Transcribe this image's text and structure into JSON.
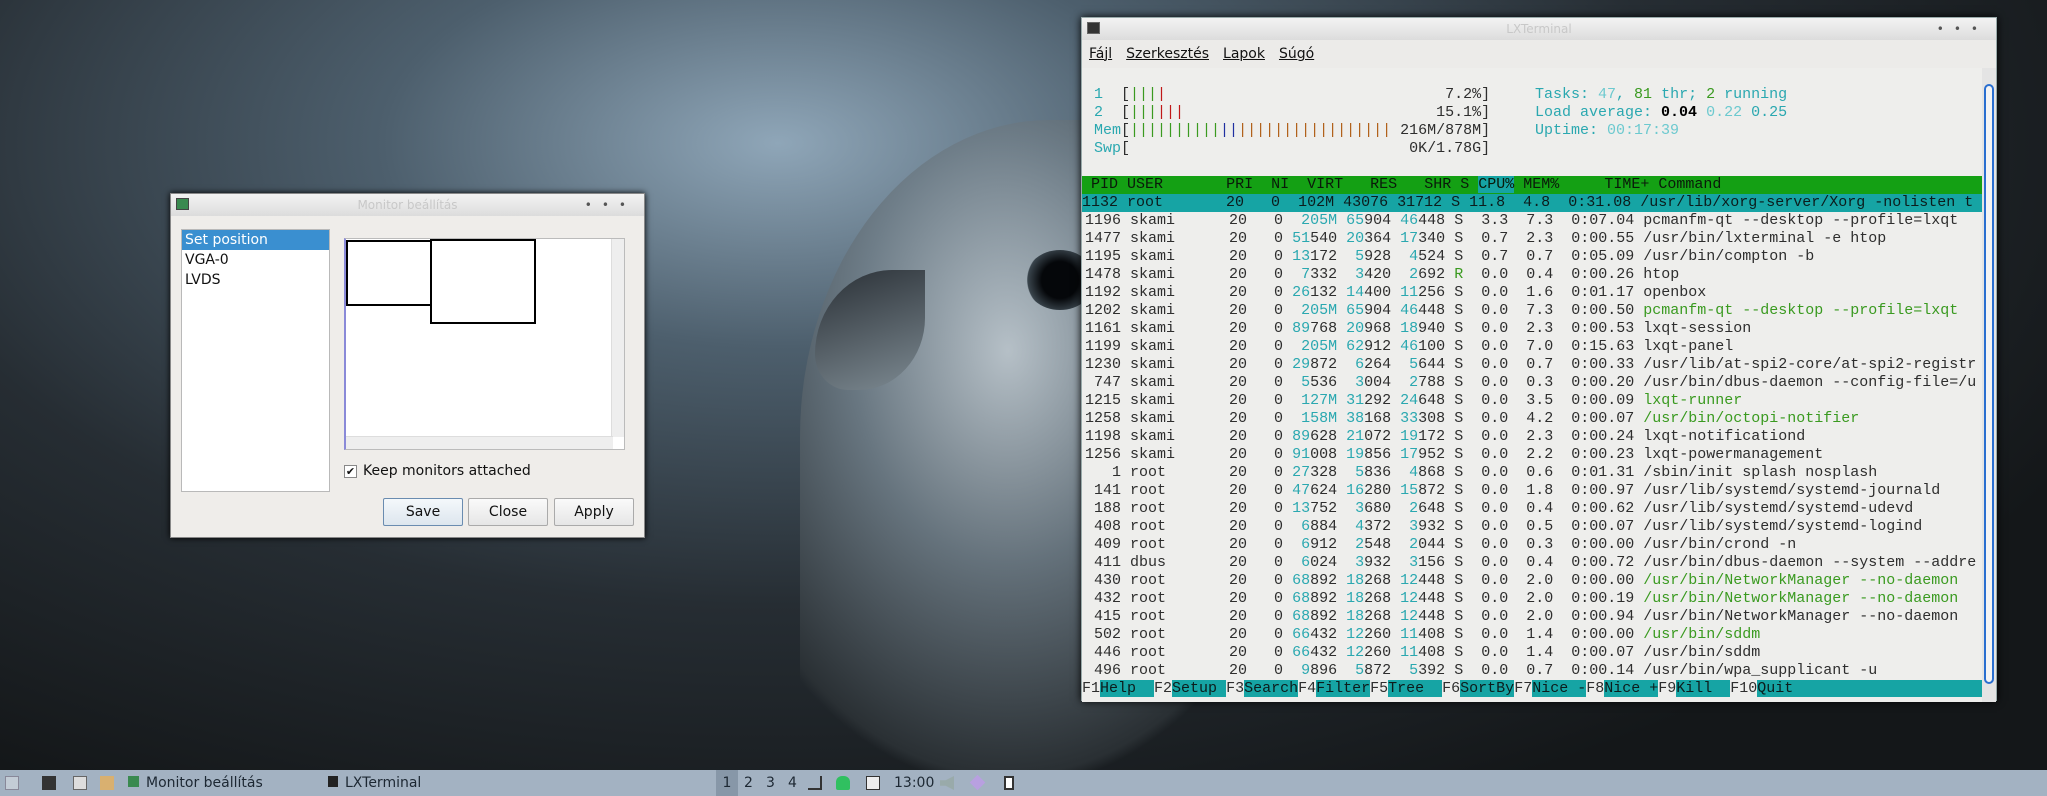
{
  "terminal": {
    "title": "LXTerminal",
    "menu": [
      "Fájl",
      "Szerkesztés",
      "Lapok",
      "Súgó"
    ],
    "meters": [
      {
        "label": "1",
        "value": "7.2%",
        "segments": [
          [
            "gr",
            3
          ],
          [
            "rd",
            1
          ]
        ]
      },
      {
        "label": "2",
        "value": "15.1%",
        "segments": [
          [
            "gr",
            3
          ],
          [
            "rd",
            3
          ]
        ]
      },
      {
        "label": "Mem",
        "value": "216M/878M",
        "segments": [
          [
            "gr",
            10
          ],
          [
            "bl",
            2
          ],
          [
            "or",
            17
          ]
        ]
      },
      {
        "label": "Swp",
        "value": "0K/1.78G",
        "segments": []
      }
    ],
    "tasks": {
      "label": "Tasks: ",
      "count": "47",
      "sep": ", ",
      "threads": "81",
      "thr_label": " thr; ",
      "running": "2",
      "running_label": " running"
    },
    "load": {
      "label": "Load average: ",
      "l1": "0.04",
      "l5": "0.22",
      "l15": "0.25"
    },
    "uptime": {
      "label": "Uptime: ",
      "value": "00:17:39"
    },
    "columns": [
      "PID",
      "USER",
      "PRI",
      "NI",
      "VIRT",
      "RES",
      "SHR",
      "S",
      "CPU%",
      "MEM%",
      "TIME+",
      "Command"
    ],
    "sort_column": "CPU%",
    "processes": [
      {
        "pid": "1132",
        "user": "root",
        "pri": "20",
        "ni": "0",
        "virt": "102M",
        "res": "43076",
        "shr": "31712",
        "s": "S",
        "cpu": "11.8",
        "mem": "4.8",
        "time": "0:31.08",
        "cmd": "/usr/lib/xorg-server/Xorg -nolisten t",
        "selected": true
      },
      {
        "pid": "1196",
        "user": "skami",
        "pri": "20",
        "ni": "0",
        "virt": "205M",
        "res": "65904",
        "shr": "46448",
        "s": "S",
        "cpu": "3.3",
        "mem": "7.3",
        "time": "0:07.04",
        "cmd": "pcmanfm-qt --desktop --profile=lxqt"
      },
      {
        "pid": "1477",
        "user": "skami",
        "pri": "20",
        "ni": "0",
        "virt": "51540",
        "res": "20364",
        "shr": "17340",
        "s": "S",
        "cpu": "0.7",
        "mem": "2.3",
        "time": "0:00.55",
        "cmd": "/usr/bin/lxterminal -e htop"
      },
      {
        "pid": "1195",
        "user": "skami",
        "pri": "20",
        "ni": "0",
        "virt": "13172",
        "res": "5928",
        "shr": "4524",
        "s": "S",
        "cpu": "0.7",
        "mem": "0.7",
        "time": "0:05.09",
        "cmd": "/usr/bin/compton -b"
      },
      {
        "pid": "1478",
        "user": "skami",
        "pri": "20",
        "ni": "0",
        "virt": "7332",
        "res": "3420",
        "shr": "2692",
        "s": "R",
        "cpu": "0.0",
        "mem": "0.4",
        "time": "0:00.26",
        "cmd": "htop"
      },
      {
        "pid": "1192",
        "user": "skami",
        "pri": "20",
        "ni": "0",
        "virt": "26132",
        "res": "14400",
        "shr": "11256",
        "s": "S",
        "cpu": "0.0",
        "mem": "1.6",
        "time": "0:01.17",
        "cmd": "openbox"
      },
      {
        "pid": "1202",
        "user": "skami",
        "pri": "20",
        "ni": "0",
        "virt": "205M",
        "res": "65904",
        "shr": "46448",
        "s": "S",
        "cpu": "0.0",
        "mem": "7.3",
        "time": "0:00.50",
        "cmd": "pcmanfm-qt --desktop --profile=lxqt",
        "thread": true
      },
      {
        "pid": "1161",
        "user": "skami",
        "pri": "20",
        "ni": "0",
        "virt": "89768",
        "res": "20968",
        "shr": "18940",
        "s": "S",
        "cpu": "0.0",
        "mem": "2.3",
        "time": "0:00.53",
        "cmd": "lxqt-session"
      },
      {
        "pid": "1199",
        "user": "skami",
        "pri": "20",
        "ni": "0",
        "virt": "205M",
        "res": "62912",
        "shr": "46100",
        "s": "S",
        "cpu": "0.0",
        "mem": "7.0",
        "time": "0:15.63",
        "cmd": "lxqt-panel"
      },
      {
        "pid": "1230",
        "user": "skami",
        "pri": "20",
        "ni": "0",
        "virt": "29872",
        "res": "6264",
        "shr": "5644",
        "s": "S",
        "cpu": "0.0",
        "mem": "0.7",
        "time": "0:00.33",
        "cmd": "/usr/lib/at-spi2-core/at-spi2-registr"
      },
      {
        "pid": "747",
        "user": "skami",
        "pri": "20",
        "ni": "0",
        "virt": "5536",
        "res": "3004",
        "shr": "2788",
        "s": "S",
        "cpu": "0.0",
        "mem": "0.3",
        "time": "0:00.20",
        "cmd": "/usr/bin/dbus-daemon --config-file=/u"
      },
      {
        "pid": "1215",
        "user": "skami",
        "pri": "20",
        "ni": "0",
        "virt": "127M",
        "res": "31292",
        "shr": "24648",
        "s": "S",
        "cpu": "0.0",
        "mem": "3.5",
        "time": "0:00.09",
        "cmd": "lxqt-runner",
        "thread": true
      },
      {
        "pid": "1258",
        "user": "skami",
        "pri": "20",
        "ni": "0",
        "virt": "158M",
        "res": "38168",
        "shr": "33308",
        "s": "S",
        "cpu": "0.0",
        "mem": "4.2",
        "time": "0:00.07",
        "cmd": "/usr/bin/octopi-notifier",
        "thread": true
      },
      {
        "pid": "1198",
        "user": "skami",
        "pri": "20",
        "ni": "0",
        "virt": "89628",
        "res": "21072",
        "shr": "19172",
        "s": "S",
        "cpu": "0.0",
        "mem": "2.3",
        "time": "0:00.24",
        "cmd": "lxqt-notificationd"
      },
      {
        "pid": "1256",
        "user": "skami",
        "pri": "20",
        "ni": "0",
        "virt": "91008",
        "res": "19856",
        "shr": "17952",
        "s": "S",
        "cpu": "0.0",
        "mem": "2.2",
        "time": "0:00.23",
        "cmd": "lxqt-powermanagement"
      },
      {
        "pid": "1",
        "user": "root",
        "pri": "20",
        "ni": "0",
        "virt": "27328",
        "res": "5836",
        "shr": "4868",
        "s": "S",
        "cpu": "0.0",
        "mem": "0.6",
        "time": "0:01.31",
        "cmd": "/sbin/init splash nosplash"
      },
      {
        "pid": "141",
        "user": "root",
        "pri": "20",
        "ni": "0",
        "virt": "47624",
        "res": "16280",
        "shr": "15872",
        "s": "S",
        "cpu": "0.0",
        "mem": "1.8",
        "time": "0:00.97",
        "cmd": "/usr/lib/systemd/systemd-journald"
      },
      {
        "pid": "188",
        "user": "root",
        "pri": "20",
        "ni": "0",
        "virt": "13752",
        "res": "3680",
        "shr": "2648",
        "s": "S",
        "cpu": "0.0",
        "mem": "0.4",
        "time": "0:00.62",
        "cmd": "/usr/lib/systemd/systemd-udevd"
      },
      {
        "pid": "408",
        "user": "root",
        "pri": "20",
        "ni": "0",
        "virt": "6884",
        "res": "4372",
        "shr": "3932",
        "s": "S",
        "cpu": "0.0",
        "mem": "0.5",
        "time": "0:00.07",
        "cmd": "/usr/lib/systemd/systemd-logind"
      },
      {
        "pid": "409",
        "user": "root",
        "pri": "20",
        "ni": "0",
        "virt": "6912",
        "res": "2548",
        "shr": "2044",
        "s": "S",
        "cpu": "0.0",
        "mem": "0.3",
        "time": "0:00.00",
        "cmd": "/usr/bin/crond -n"
      },
      {
        "pid": "411",
        "user": "dbus",
        "pri": "20",
        "ni": "0",
        "virt": "6024",
        "res": "3932",
        "shr": "3156",
        "s": "S",
        "cpu": "0.0",
        "mem": "0.4",
        "time": "0:00.72",
        "cmd": "/usr/bin/dbus-daemon --system --addre"
      },
      {
        "pid": "430",
        "user": "root",
        "pri": "20",
        "ni": "0",
        "virt": "68892",
        "res": "18268",
        "shr": "12448",
        "s": "S",
        "cpu": "0.0",
        "mem": "2.0",
        "time": "0:00.00",
        "cmd": "/usr/bin/NetworkManager --no-daemon",
        "thread": true
      },
      {
        "pid": "432",
        "user": "root",
        "pri": "20",
        "ni": "0",
        "virt": "68892",
        "res": "18268",
        "shr": "12448",
        "s": "S",
        "cpu": "0.0",
        "mem": "2.0",
        "time": "0:00.19",
        "cmd": "/usr/bin/NetworkManager --no-daemon",
        "thread": true
      },
      {
        "pid": "415",
        "user": "root",
        "pri": "20",
        "ni": "0",
        "virt": "68892",
        "res": "18268",
        "shr": "12448",
        "s": "S",
        "cpu": "0.0",
        "mem": "2.0",
        "time": "0:00.94",
        "cmd": "/usr/bin/NetworkManager --no-daemon"
      },
      {
        "pid": "502",
        "user": "root",
        "pri": "20",
        "ni": "0",
        "virt": "66432",
        "res": "12260",
        "shr": "11408",
        "s": "S",
        "cpu": "0.0",
        "mem": "1.4",
        "time": "0:00.00",
        "cmd": "/usr/bin/sddm",
        "thread": true
      },
      {
        "pid": "446",
        "user": "root",
        "pri": "20",
        "ni": "0",
        "virt": "66432",
        "res": "12260",
        "shr": "11408",
        "s": "S",
        "cpu": "0.0",
        "mem": "1.4",
        "time": "0:00.07",
        "cmd": "/usr/bin/sddm"
      },
      {
        "pid": "496",
        "user": "root",
        "pri": "20",
        "ni": "0",
        "virt": "9896",
        "res": "5872",
        "shr": "5392",
        "s": "S",
        "cpu": "0.0",
        "mem": "0.7",
        "time": "0:00.14",
        "cmd": "/usr/bin/wpa_supplicant -u"
      }
    ],
    "fkeys": [
      [
        "F1",
        "Help  "
      ],
      [
        "F2",
        "Setup "
      ],
      [
        "F3",
        "Search"
      ],
      [
        "F4",
        "Filter"
      ],
      [
        "F5",
        "Tree  "
      ],
      [
        "F6",
        "SortBy"
      ],
      [
        "F7",
        "Nice -"
      ],
      [
        "F8",
        "Nice +"
      ],
      [
        "F9",
        "Kill  "
      ],
      [
        "F10",
        "Quit"
      ]
    ]
  },
  "dialog": {
    "title": "Monitor beállítás",
    "list": [
      "Set position",
      "VGA-0",
      "LVDS"
    ],
    "checkbox_label": "Keep monitors attached",
    "checkbox_checked": true,
    "save": "Save",
    "close": "Close",
    "apply": "Apply"
  },
  "taskbar": {
    "tasks": [
      "Monitor beállítás",
      "LXTerminal"
    ],
    "desktops": [
      "1",
      "2",
      "3",
      "4"
    ],
    "active_desktop": "1",
    "clock": "13:00"
  }
}
